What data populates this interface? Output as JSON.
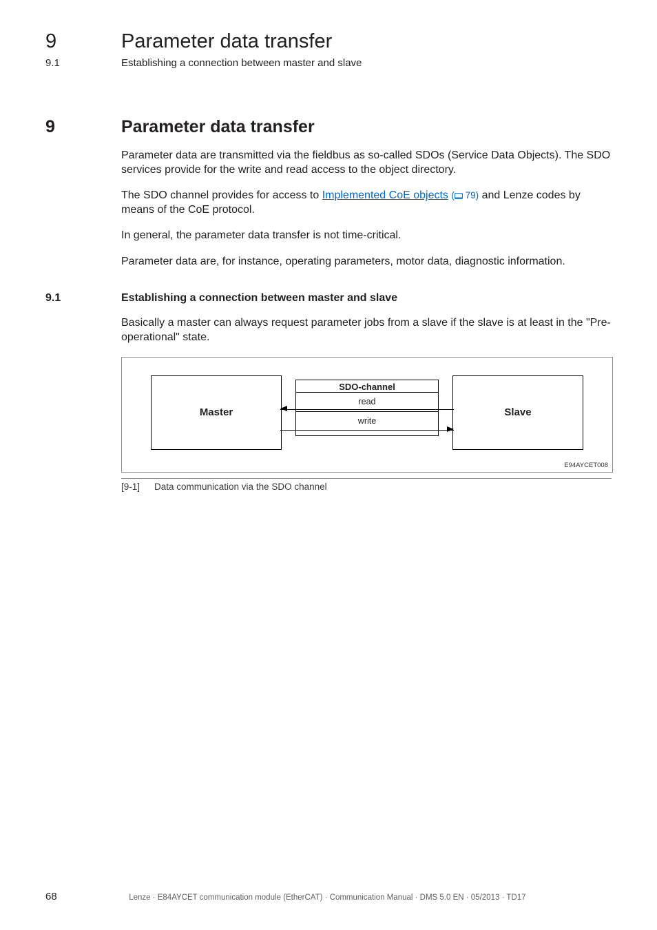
{
  "running_header": {
    "chapter_number": "9",
    "chapter_title": "Parameter data transfer",
    "section_number": "9.1",
    "section_title": "Establishing a connection between master and slave"
  },
  "divider_glyphs": "_ _ _ _ _ _ _ _ _ _ _ _ _ _ _ _ _ _ _ _ _ _ _ _ _ _ _ _ _ _ _ _ _ _ _ _ _ _ _ _ _ _ _ _ _ _ _ _ _ _ _ _ _ _ _ _ _ _ _ _ _ _ _ _",
  "heading1": {
    "number": "9",
    "title": "Parameter data transfer"
  },
  "body": {
    "p1": "Parameter data are transmitted via the fieldbus as so-called SDOs (Service Data Objects). The SDO services provide for the write and read access to the object directory.",
    "p2_pre": "The SDO channel provides for access to ",
    "p2_link": "Implemented CoE objects",
    "p2_xref_page": "79",
    "p2_post": " and Lenze codes by means of the CoE protocol.",
    "p3": "In general, the parameter data transfer is not time-critical.",
    "p4": "Parameter data are, for instance, operating parameters, motor data, diagnostic information."
  },
  "heading2": {
    "number": "9.1",
    "title": "Establishing a connection between master and slave"
  },
  "section_body": {
    "p1": "Basically a master can always request parameter jobs from a slave if the slave is at least in the \"Pre-operational\" state."
  },
  "figure": {
    "master_label": "Master",
    "slave_label": "Slave",
    "channel_title": "SDO-channel",
    "row_read": "read",
    "row_write": "write",
    "code": "E94AYCET008",
    "caption_key": "[9-1]",
    "caption_text": "Data communication via the SDO channel"
  },
  "footer": {
    "page_number": "68",
    "doc_id": "Lenze · E84AYCET communication module (EtherCAT) · Communication Manual · DMS 5.0 EN · 05/2013 · TD17"
  }
}
